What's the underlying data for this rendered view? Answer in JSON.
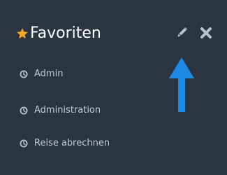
{
  "panel": {
    "title": "Favoriten",
    "icons": {
      "title": "star-icon",
      "edit": "pencil-icon",
      "close": "close-icon",
      "items": "clock-icon"
    },
    "items": [
      {
        "label": "Admin"
      },
      {
        "label": "Administration"
      },
      {
        "label": "Reise abrechnen"
      }
    ]
  },
  "annotation": {
    "icon": "arrow-up-icon",
    "color": "#1e88e5"
  },
  "colors": {
    "background": "#2b3541",
    "star": "#f5a623",
    "title": "#ffffff",
    "item_text": "#c3ccd6",
    "icon": "#b8c2cc"
  }
}
